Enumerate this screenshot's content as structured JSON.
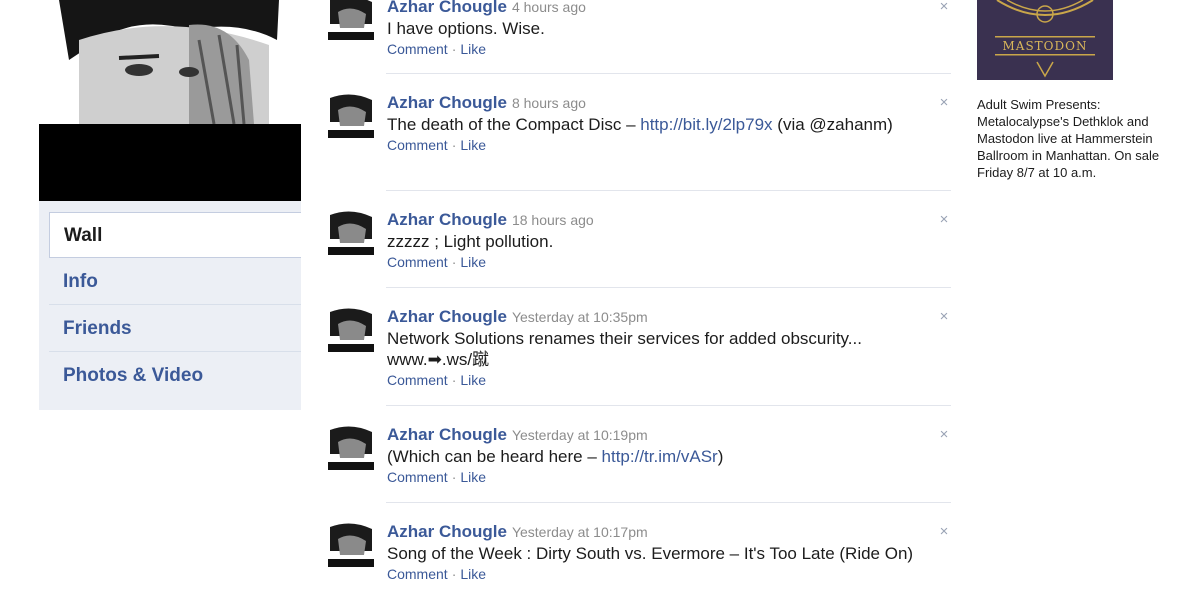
{
  "left_nav": {
    "items": [
      {
        "label": "Wall",
        "active": true
      },
      {
        "label": "Info",
        "active": false
      },
      {
        "label": "Friends",
        "active": false
      },
      {
        "label": "Photos & Video",
        "active": false
      }
    ]
  },
  "feed": {
    "stories": [
      {
        "author": "Azhar Chougle",
        "time": "4 hours ago",
        "text_before": "I have options. Wise.",
        "link": "",
        "text_after": "",
        "comment_label": "Comment",
        "like_label": "Like",
        "separator": "·"
      },
      {
        "author": "Azhar Chougle",
        "time": "8 hours ago",
        "text_before": "The death of the Compact Disc – ",
        "link": "http://bit.ly/2lp79x",
        "text_after": " (via @zahanm)",
        "comment_label": "Comment",
        "like_label": "Like",
        "separator": "·"
      },
      {
        "author": "Azhar Chougle",
        "time": "18 hours ago",
        "text_before": "zzzzz ; Light pollution.",
        "link": "",
        "text_after": "",
        "comment_label": "Comment",
        "like_label": "Like",
        "separator": "·"
      },
      {
        "author": "Azhar Chougle",
        "time": "Yesterday at 10:35pm",
        "text_before": "Network Solutions renames their services for added obscurity... www.➡.ws/蹴",
        "link": "",
        "text_after": "",
        "comment_label": "Comment",
        "like_label": "Like",
        "separator": "·"
      },
      {
        "author": "Azhar Chougle",
        "time": "Yesterday at 10:19pm",
        "text_before": "(Which can be heard here – ",
        "link": "http://tr.im/vASr",
        "text_after": ")",
        "comment_label": "Comment",
        "like_label": "Like",
        "separator": "·"
      },
      {
        "author": "Azhar Chougle",
        "time": "Yesterday at 10:17pm",
        "text_before": "Song of the Week : Dirty South vs. Evermore – It's Too Late (Ride On)",
        "link": "",
        "text_after": "",
        "comment_label": "Comment",
        "like_label": "Like",
        "separator": "·"
      }
    ],
    "remove_glyph": "×"
  },
  "sidebar": {
    "ad": {
      "image_text": "MASTODON",
      "text": "Adult Swim Presents: Metalocalypse's Dethklok and Mastodon live at Hammerstein Ballroom in Manhattan. On sale Friday 8/7 at 10 a.m."
    }
  },
  "colors": {
    "link": "#3b5998",
    "nav_bg": "#eceff5",
    "timestamp": "#8c8c8c",
    "divider": "#e2e5ec"
  }
}
